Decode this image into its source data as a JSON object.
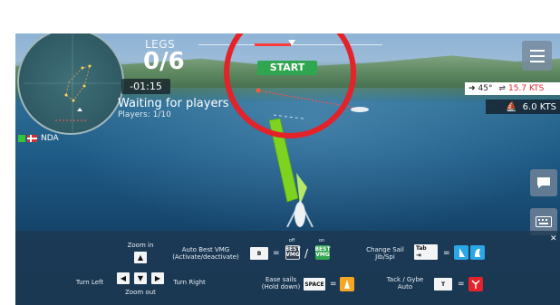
{
  "hud": {
    "legs_label": "LEGS",
    "legs_value": "0/6",
    "timer": "-01:15",
    "status": "Waiting for players",
    "players": "Players: 1/10",
    "player_tag": "NDA",
    "start_label": "START"
  },
  "wind": {
    "angle": "45°",
    "speed": "15.7 KTS"
  },
  "boat": {
    "speed": "6.0 KTS"
  },
  "controls": {
    "zoom_in": "Zoom in",
    "zoom_out": "Zoom out",
    "turn_left": "Turn Left",
    "turn_right": "Turn Right",
    "auto_best_vmg": "Auto Best VMG\n(Activate/deactivate)",
    "vmg_off_label": "off",
    "vmg_on_label": "on",
    "vmg_icon_text": "BEST\nVMG",
    "ease_sails": "Ease sails\n(Hold down)",
    "space_key": "SPACE",
    "change_sail": "Change Sail\nJib/Spi",
    "tab_key": "Tab",
    "tack_gybe": "Tack / Gybe\nAuto",
    "t_key": "T",
    "b_key": "B"
  },
  "colors": {
    "start_green": "#2fa64f",
    "highlight_red": "#e3222a",
    "boat_green": "#7ed321",
    "sail_blue": "#2aa7e6",
    "ease_orange": "#f5a623",
    "tack_red": "#e3222a"
  },
  "icons": [
    "hamburger-menu-icon",
    "chat-icon",
    "keyboard-icon",
    "close-icon",
    "wind-arrow-icon",
    "boat-speed-icon"
  ]
}
